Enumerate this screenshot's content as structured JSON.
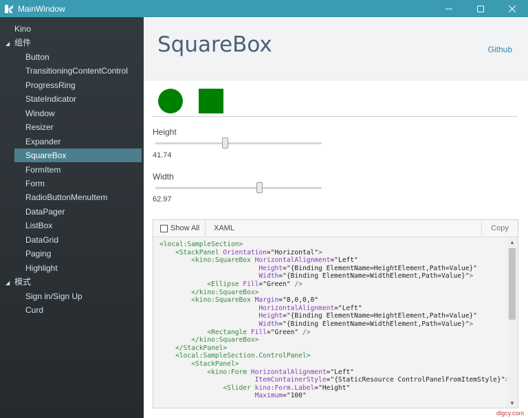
{
  "window": {
    "title": "MainWindow",
    "accent_color": "#3a9bb1",
    "icon": "kino-logo-icon",
    "controls": [
      "minimize-icon",
      "maximize-icon",
      "close-icon"
    ]
  },
  "sidebar": {
    "background": "#2d3237",
    "selected_color": "#4b7f8e",
    "items": [
      {
        "label": "Kino",
        "level": 0
      },
      {
        "label": "组件",
        "level": 0,
        "group": true,
        "arrow": "◢"
      },
      {
        "label": "Button",
        "level": 1
      },
      {
        "label": "TransitioningContentControl",
        "level": 1
      },
      {
        "label": "ProgressRing",
        "level": 1
      },
      {
        "label": "StateIndicator",
        "level": 1
      },
      {
        "label": "Window",
        "level": 1
      },
      {
        "label": "Resizer",
        "level": 1
      },
      {
        "label": "Expander",
        "level": 1
      },
      {
        "label": "SquareBox",
        "level": 1,
        "selected": true
      },
      {
        "label": "FormItem",
        "level": 1
      },
      {
        "label": "Form",
        "level": 1
      },
      {
        "label": "RadioButtonMenuItem",
        "level": 1
      },
      {
        "label": "DataPager",
        "level": 1
      },
      {
        "label": "ListBox",
        "level": 1
      },
      {
        "label": "DataGrid",
        "level": 1
      },
      {
        "label": "Paging",
        "level": 1
      },
      {
        "label": "Highlight",
        "level": 1
      },
      {
        "label": "模式",
        "level": 0,
        "group": true,
        "arrow": "◢"
      },
      {
        "label": "Sign in/Sign Up",
        "level": 1
      },
      {
        "label": "Curd",
        "level": 1
      }
    ]
  },
  "header": {
    "title": "SquareBox",
    "github_link": "Github"
  },
  "demo": {
    "fill_color": "#008000"
  },
  "controls": {
    "height": {
      "label": "Height",
      "value": "41.74",
      "fraction": 0.4174
    },
    "width": {
      "label": "Width",
      "value": "62.97",
      "fraction": 0.6297
    }
  },
  "code_panel": {
    "show_all_label": "Show All",
    "tab_label": "XAML",
    "copy_label": "Copy",
    "lines": [
      [
        [
          "t",
          "<local:SampleSection>"
        ]
      ],
      [
        [
          "s",
          "    "
        ],
        [
          "t",
          "<StackPanel "
        ],
        [
          "a",
          "Orientation"
        ],
        [
          "v",
          "=\"Horizontal\""
        ],
        [
          "t",
          ">"
        ]
      ],
      [
        [
          "s",
          "        "
        ],
        [
          "t",
          "<kino:SquareBox "
        ],
        [
          "a",
          "HorizontalAlignment"
        ],
        [
          "v",
          "=\"Left\""
        ]
      ],
      [
        [
          "s",
          "                         "
        ],
        [
          "a",
          "Height"
        ],
        [
          "v",
          "=\"{Binding ElementName=HeightElement,Path=Value}\""
        ]
      ],
      [
        [
          "s",
          "                         "
        ],
        [
          "a",
          "Width"
        ],
        [
          "v",
          "=\"{Binding ElementName=WidthElement,Path=Value}\""
        ],
        [
          "t",
          ">"
        ]
      ],
      [
        [
          "s",
          "            "
        ],
        [
          "t",
          "<Ellipse "
        ],
        [
          "a",
          "Fill"
        ],
        [
          "v",
          "=\"Green\""
        ],
        [
          "t",
          " />"
        ]
      ],
      [
        [
          "s",
          "        "
        ],
        [
          "t",
          "</kino:SquareBox>"
        ]
      ],
      [
        [
          "s",
          "        "
        ],
        [
          "t",
          "<kino:SquareBox "
        ],
        [
          "a",
          "Margin"
        ],
        [
          "v",
          "=\"8,0,0,0\""
        ]
      ],
      [
        [
          "s",
          "                         "
        ],
        [
          "a",
          "HorizontalAlignment"
        ],
        [
          "v",
          "=\"Left\""
        ]
      ],
      [
        [
          "s",
          "                         "
        ],
        [
          "a",
          "Height"
        ],
        [
          "v",
          "=\"{Binding ElementName=HeightElement,Path=Value}\""
        ]
      ],
      [
        [
          "s",
          "                         "
        ],
        [
          "a",
          "Width"
        ],
        [
          "v",
          "=\"{Binding ElementName=WidthElement,Path=Value}\""
        ],
        [
          "t",
          ">"
        ]
      ],
      [
        [
          "s",
          "            "
        ],
        [
          "t",
          "<Rectangle "
        ],
        [
          "a",
          "Fill"
        ],
        [
          "v",
          "=\"Green\""
        ],
        [
          "t",
          " />"
        ]
      ],
      [
        [
          "s",
          "        "
        ],
        [
          "t",
          "</kino:SquareBox>"
        ]
      ],
      [
        [
          "s",
          "    "
        ],
        [
          "t",
          "</StackPanel>"
        ]
      ],
      [
        [
          "s",
          "    "
        ],
        [
          "t",
          "<local:SampleSection.ControlPanel>"
        ]
      ],
      [
        [
          "s",
          "        "
        ],
        [
          "t",
          "<StackPanel>"
        ]
      ],
      [
        [
          "s",
          "            "
        ],
        [
          "t",
          "<kino:Form "
        ],
        [
          "a",
          "HorizontalAlignment"
        ],
        [
          "v",
          "=\"Left\""
        ]
      ],
      [
        [
          "s",
          "                        "
        ],
        [
          "a",
          "ItemContainerStyle"
        ],
        [
          "v",
          "=\"{StaticResource ControlPanelFromItemStyle}\""
        ],
        [
          "t",
          ">"
        ]
      ],
      [
        [
          "s",
          "                "
        ],
        [
          "t",
          "<Slider "
        ],
        [
          "a",
          "kino:Form.Label"
        ],
        [
          "v",
          "=\"Height\""
        ]
      ],
      [
        [
          "s",
          "                        "
        ],
        [
          "a",
          "Maximum"
        ],
        [
          "v",
          "=\"100\""
        ]
      ]
    ]
  },
  "watermark": "dlgcy.com"
}
